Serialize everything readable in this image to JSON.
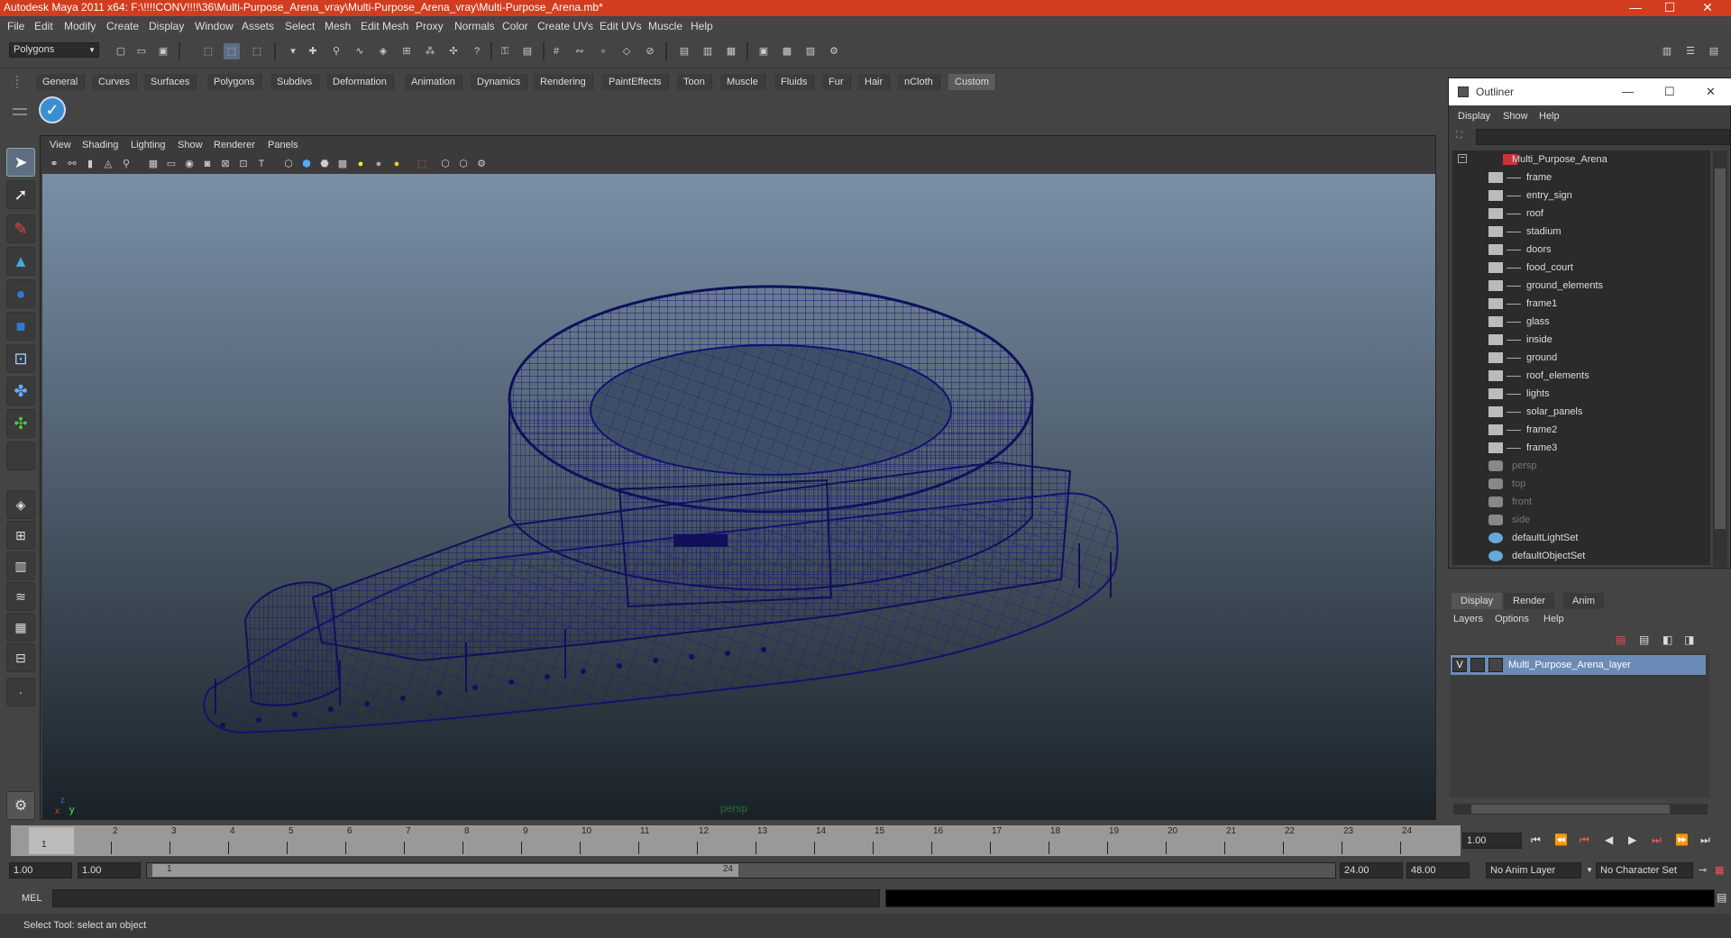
{
  "titlebar": {
    "title": "Autodesk Maya 2011 x64: F:\\!!!!CONV!!!!\\36\\Multi-Purpose_Arena_vray\\Multi-Purpose_Arena_vray\\Multi-Purpose_Arena.mb*",
    "minimize": "—",
    "maximize": "☐",
    "close": "✕"
  },
  "menubar": [
    "File",
    "Edit",
    "Modify",
    "Create",
    "Display",
    "Window",
    "Assets",
    "Select",
    "Mesh",
    "Edit Mesh",
    "Proxy",
    "Normals",
    "Color",
    "Create UVs",
    "Edit UVs",
    "Muscle",
    "Help"
  ],
  "statusline": {
    "mode": "Polygons"
  },
  "shelf": {
    "tabs": [
      "General",
      "Curves",
      "Surfaces",
      "Polygons",
      "Subdivs",
      "Deformation",
      "Animation",
      "Dynamics",
      "Rendering",
      "PaintEffects",
      "Toon",
      "Muscle",
      "Fluids",
      "Fur",
      "Hair",
      "nCloth",
      "Custom"
    ],
    "active": "Custom"
  },
  "panel": {
    "menu": [
      "View",
      "Shading",
      "Lighting",
      "Show",
      "Renderer",
      "Panels"
    ],
    "camera": "persp",
    "axis_x": "x",
    "axis_y": "y",
    "axis_z": "z"
  },
  "outliner": {
    "title": "Outliner",
    "menu": [
      "Display",
      "Show",
      "Help"
    ],
    "items": [
      {
        "name": "Multi_Purpose_Arena",
        "depth": 0,
        "kind": "group"
      },
      {
        "name": "frame",
        "depth": 1,
        "kind": "mesh"
      },
      {
        "name": "entry_sign",
        "depth": 1,
        "kind": "mesh"
      },
      {
        "name": "roof",
        "depth": 1,
        "kind": "mesh"
      },
      {
        "name": "stadium",
        "depth": 1,
        "kind": "mesh"
      },
      {
        "name": "doors",
        "depth": 1,
        "kind": "mesh"
      },
      {
        "name": "food_court",
        "depth": 1,
        "kind": "mesh"
      },
      {
        "name": "ground_elements",
        "depth": 1,
        "kind": "mesh"
      },
      {
        "name": "frame1",
        "depth": 1,
        "kind": "mesh"
      },
      {
        "name": "glass",
        "depth": 1,
        "kind": "mesh"
      },
      {
        "name": "inside",
        "depth": 1,
        "kind": "mesh"
      },
      {
        "name": "ground",
        "depth": 1,
        "kind": "mesh"
      },
      {
        "name": "roof_elements",
        "depth": 1,
        "kind": "mesh"
      },
      {
        "name": "lights",
        "depth": 1,
        "kind": "mesh"
      },
      {
        "name": "solar_panels",
        "depth": 1,
        "kind": "mesh"
      },
      {
        "name": "frame2",
        "depth": 1,
        "kind": "mesh"
      },
      {
        "name": "frame3",
        "depth": 1,
        "kind": "mesh"
      },
      {
        "name": "persp",
        "depth": 0,
        "kind": "camera"
      },
      {
        "name": "top",
        "depth": 0,
        "kind": "camera"
      },
      {
        "name": "front",
        "depth": 0,
        "kind": "camera"
      },
      {
        "name": "side",
        "depth": 0,
        "kind": "camera"
      },
      {
        "name": "defaultLightSet",
        "depth": 0,
        "kind": "set"
      },
      {
        "name": "defaultObjectSet",
        "depth": 0,
        "kind": "set"
      }
    ]
  },
  "layer_editor": {
    "tabs": [
      "Display",
      "Render",
      "Anim"
    ],
    "active_tab": "Display",
    "menu": [
      "Layers",
      "Options",
      "Help"
    ],
    "layer": {
      "visible": "V",
      "name": "Multi_Purpose_Arena_layer"
    }
  },
  "timeline": {
    "ticks": [
      "1",
      "2",
      "3",
      "4",
      "5",
      "6",
      "7",
      "8",
      "9",
      "10",
      "11",
      "12",
      "13",
      "14",
      "15",
      "16",
      "17",
      "18",
      "19",
      "20",
      "21",
      "22",
      "23",
      "24"
    ],
    "current_marker": "1",
    "current_frame": "1.00"
  },
  "range": {
    "start": "1.00",
    "anim_start": "1.00",
    "range_start_label": "1",
    "range_end_label": "24",
    "end": "24.00",
    "anim_end": "48.00",
    "anim_layer": "No Anim Layer",
    "character_set": "No Character Set"
  },
  "command_line": {
    "label": "MEL"
  },
  "help_line": "Select Tool: select an object"
}
